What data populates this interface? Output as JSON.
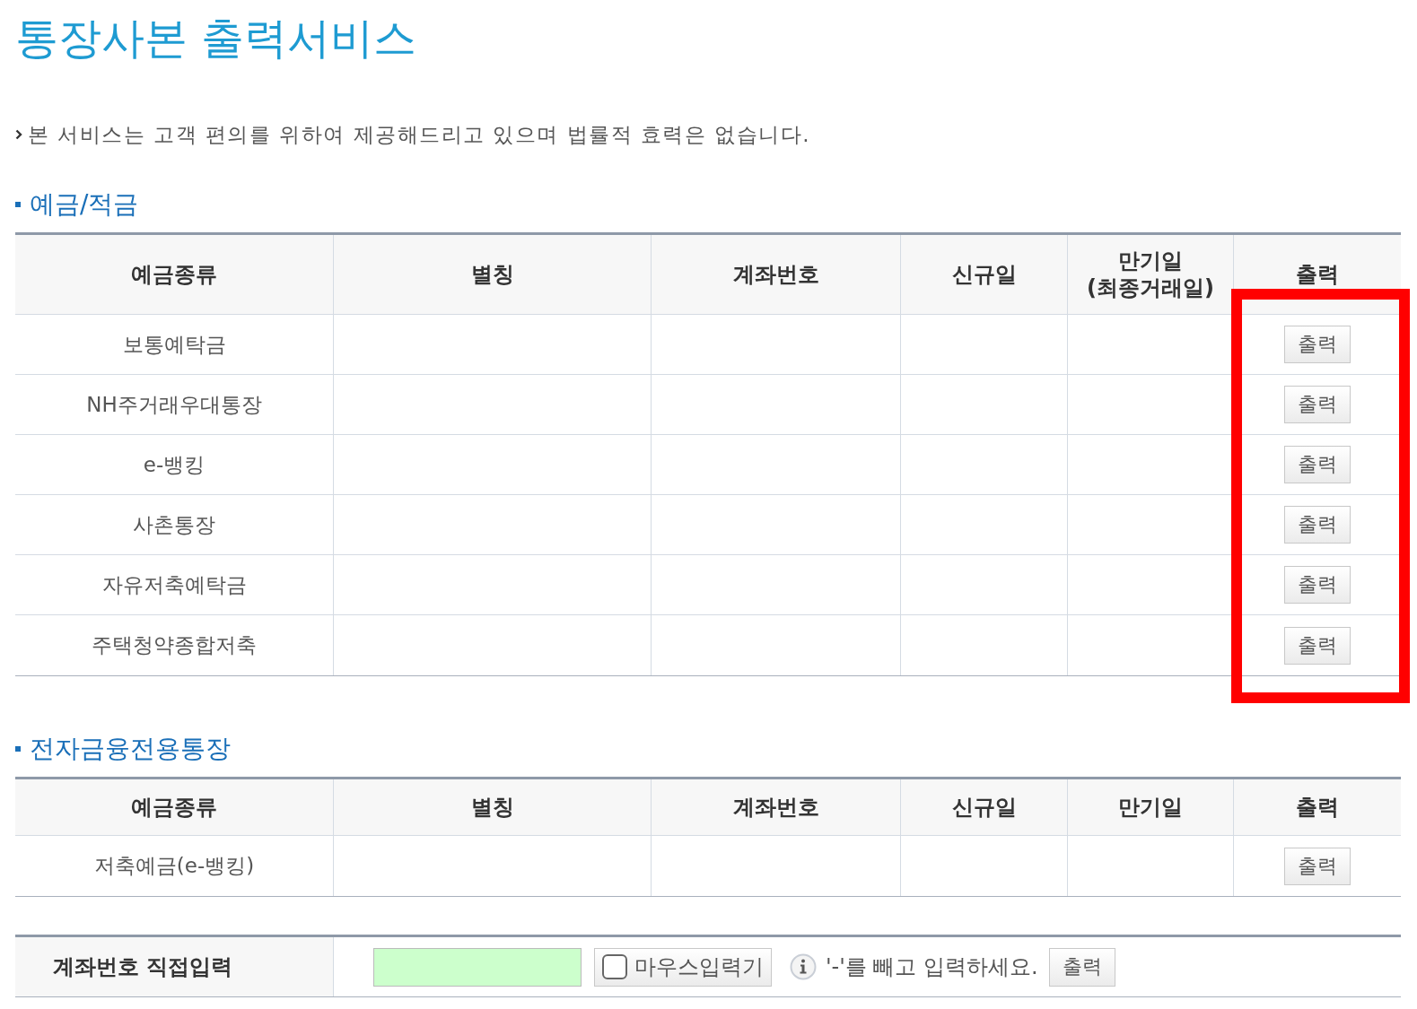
{
  "page_title": "통장사본 출력서비스",
  "notice": "본 서비스는 고객 편의를 위하여 제공해드리고 있으며 법률적 효력은 없습니다.",
  "sections": [
    {
      "heading": "예금/적금",
      "highlighted": true,
      "columns": [
        "예금종류",
        "별칭",
        "계좌번호",
        "신규일",
        "만기일 (최종거래일)",
        "출력"
      ],
      "rows": [
        {
          "deposit_type": "보통예탁금",
          "action": "출력"
        },
        {
          "deposit_type": "NH주거래우대통장",
          "action": "출력"
        },
        {
          "deposit_type": "e-뱅킹",
          "action": "출력"
        },
        {
          "deposit_type": "사촌통장",
          "action": "출력"
        },
        {
          "deposit_type": "자유저축예탁금",
          "action": "출력"
        },
        {
          "deposit_type": "주택청약종합저축",
          "action": "출력"
        }
      ]
    },
    {
      "heading": "전자금융전용통장",
      "highlighted": false,
      "columns": [
        "예금종류",
        "별칭",
        "계좌번호",
        "신규일",
        "만기일",
        "출력"
      ],
      "rows": [
        {
          "deposit_type": "저축예금(e-뱅킹)",
          "action": "출력"
        }
      ]
    }
  ],
  "direct_input": {
    "label": "계좌번호 직접입력",
    "mouse_input": {
      "label": "마우스입력기",
      "checked": false
    },
    "hint": "'-'를 빼고 입력하세요.",
    "button": "출력"
  }
}
